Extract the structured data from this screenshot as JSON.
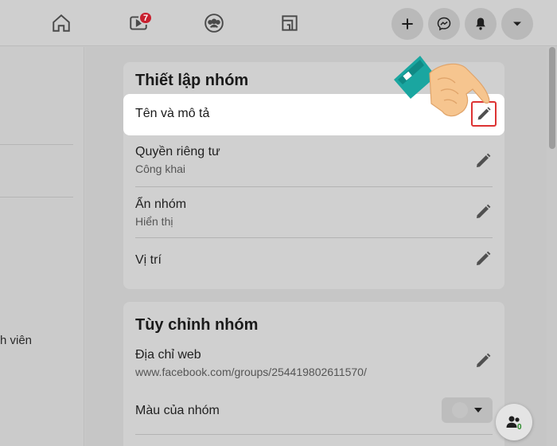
{
  "topbar": {
    "icons": [
      "home-icon",
      "watch-icon",
      "groups-icon",
      "gaming-icon"
    ],
    "watch_badge": "7",
    "actions": [
      "plus-icon",
      "messenger-icon",
      "notifications-icon",
      "dropdown-icon"
    ]
  },
  "sidebar": {
    "member_text": "h viên"
  },
  "group_settings": {
    "title": "Thiết lập nhóm",
    "rows": [
      {
        "label": "Tên và mô tả",
        "sub": ""
      },
      {
        "label": "Quyền riêng tư",
        "sub": "Công khai"
      },
      {
        "label": "Ẩn nhóm",
        "sub": "Hiển thị"
      },
      {
        "label": "Vị trí",
        "sub": ""
      }
    ]
  },
  "customize_group": {
    "title": "Tùy chỉnh nhóm",
    "web_address_label": "Địa chỉ web",
    "web_address_value": "www.facebook.com/groups/254419802611570/",
    "color_label": "Màu của nhóm"
  },
  "fab": {
    "count": "0"
  },
  "colors": {
    "highlight_border": "#dd3333",
    "badge": "#c8202f",
    "sleeve": "#1aa6a0",
    "hand": "#f6c58f"
  }
}
